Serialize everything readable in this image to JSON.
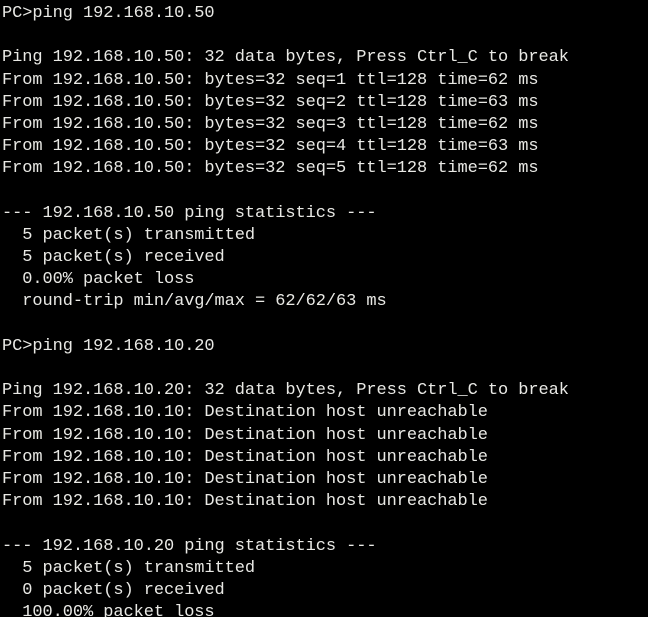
{
  "terminal": {
    "app_kind": "network-device-command-prompt",
    "background_color": "#000000",
    "text_color": "#e9e9e5",
    "prompt_symbol": "PC>",
    "lines": [
      "PC>ping 192.168.10.50",
      "",
      "Ping 192.168.10.50: 32 data bytes, Press Ctrl_C to break",
      "From 192.168.10.50: bytes=32 seq=1 ttl=128 time=62 ms",
      "From 192.168.10.50: bytes=32 seq=2 ttl=128 time=63 ms",
      "From 192.168.10.50: bytes=32 seq=3 ttl=128 time=62 ms",
      "From 192.168.10.50: bytes=32 seq=4 ttl=128 time=63 ms",
      "From 192.168.10.50: bytes=32 seq=5 ttl=128 time=62 ms",
      "",
      "--- 192.168.10.50 ping statistics ---",
      "  5 packet(s) transmitted",
      "  5 packet(s) received",
      "  0.00% packet loss",
      "  round-trip min/avg/max = 62/62/63 ms",
      "",
      "PC>ping 192.168.10.20",
      "",
      "Ping 192.168.10.20: 32 data bytes, Press Ctrl_C to break",
      "From 192.168.10.10: Destination host unreachable",
      "From 192.168.10.10: Destination host unreachable",
      "From 192.168.10.10: Destination host unreachable",
      "From 192.168.10.10: Destination host unreachable",
      "From 192.168.10.10: Destination host unreachable",
      "",
      "--- 192.168.10.20 ping statistics ---",
      "  5 packet(s) transmitted",
      "  0 packet(s) received",
      "  100.00% packet loss"
    ],
    "sessions": [
      {
        "command": "ping 192.168.10.50",
        "target": "192.168.10.50",
        "data_bytes": "32",
        "break_hint": "Press Ctrl_C to break",
        "replies": [
          {
            "from": "192.168.10.50",
            "bytes": "32",
            "seq": "1",
            "ttl": "128",
            "time": "62",
            "unit": "ms"
          },
          {
            "from": "192.168.10.50",
            "bytes": "32",
            "seq": "2",
            "ttl": "128",
            "time": "63",
            "unit": "ms"
          },
          {
            "from": "192.168.10.50",
            "bytes": "32",
            "seq": "3",
            "ttl": "128",
            "time": "62",
            "unit": "ms"
          },
          {
            "from": "192.168.10.50",
            "bytes": "32",
            "seq": "4",
            "ttl": "128",
            "time": "63",
            "unit": "ms"
          },
          {
            "from": "192.168.10.50",
            "bytes": "32",
            "seq": "5",
            "ttl": "128",
            "time": "62",
            "unit": "ms"
          }
        ],
        "statistics": {
          "header": "--- 192.168.10.50 ping statistics ---",
          "transmitted": "5 packet(s) transmitted",
          "received": "5 packet(s) received",
          "packet_loss": "0.00% packet loss",
          "round_trip": "round-trip min/avg/max = 62/62/63 ms"
        }
      },
      {
        "command": "ping 192.168.10.20",
        "target": "192.168.10.20",
        "data_bytes": "32",
        "break_hint": "Press Ctrl_C to break",
        "replies": [
          {
            "from": "192.168.10.10",
            "message": "Destination host unreachable"
          },
          {
            "from": "192.168.10.10",
            "message": "Destination host unreachable"
          },
          {
            "from": "192.168.10.10",
            "message": "Destination host unreachable"
          },
          {
            "from": "192.168.10.10",
            "message": "Destination host unreachable"
          },
          {
            "from": "192.168.10.10",
            "message": "Destination host unreachable"
          }
        ],
        "statistics": {
          "header": "--- 192.168.10.20 ping statistics ---",
          "transmitted": "5 packet(s) transmitted",
          "received": "0 packet(s) received",
          "packet_loss": "100.00% packet loss",
          "round_trip": ""
        }
      }
    ]
  }
}
